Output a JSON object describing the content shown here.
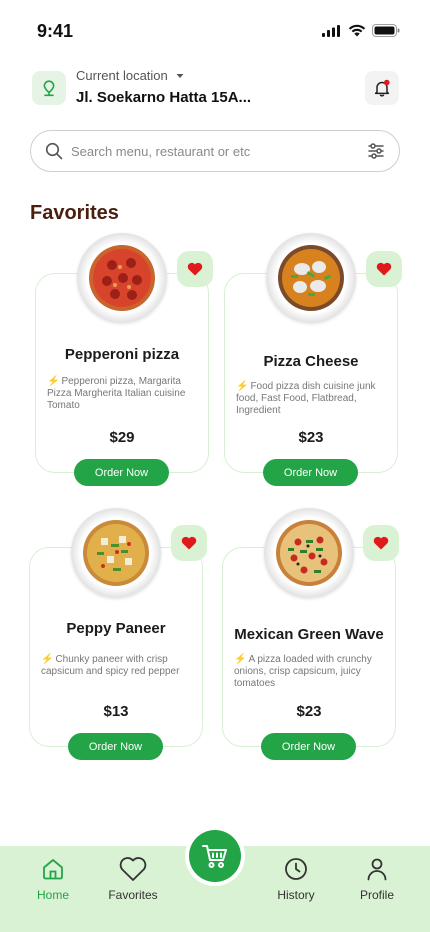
{
  "status_bar": {
    "time": "9:41"
  },
  "header": {
    "location_label": "Current location",
    "location_value": "Jl. Soekarno Hatta 15A..."
  },
  "search": {
    "placeholder": "Search menu, restaurant or etc"
  },
  "favorites": {
    "title": "Favorites",
    "items": [
      {
        "name": "Pepperoni pizza",
        "description": "Pepperoni pizza, Margarita Pizza Margherita Italian cuisine Tomato",
        "price": "$29",
        "order_label": "Order Now"
      },
      {
        "name": "Pizza Cheese",
        "description": "Food pizza dish cuisine junk food, Fast Food, Flatbread, Ingredient",
        "price": "$23",
        "order_label": "Order Now"
      },
      {
        "name": "Peppy Paneer",
        "description": "Chunky paneer with crisp capsicum and spicy red pepper",
        "price": "$13",
        "order_label": "Order Now"
      },
      {
        "name": "Mexican Green Wave",
        "description": "A pizza loaded with crunchy onions, crisp capsicum, juicy tomatoes",
        "price": "$23",
        "order_label": "Order Now"
      }
    ]
  },
  "bottom_nav": {
    "items": [
      {
        "label": "Home",
        "icon": "home-icon",
        "active": true
      },
      {
        "label": "Favorites",
        "icon": "heart-icon"
      },
      {
        "label": "History",
        "icon": "clock-icon"
      },
      {
        "label": "Profile",
        "icon": "user-icon"
      }
    ],
    "cart_icon": "cart-icon"
  },
  "colors": {
    "accent": "#22a447",
    "accent_light": "#d9f2d4",
    "heart": "#e0191a",
    "title": "#4a1f10"
  }
}
